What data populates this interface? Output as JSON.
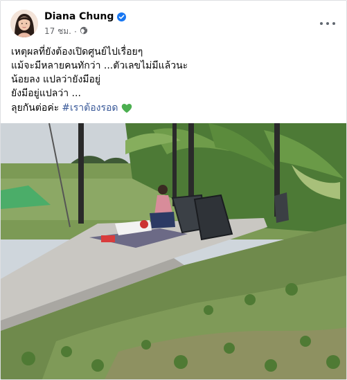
{
  "post": {
    "author_name": "Diana Chung",
    "timestamp": "17 ชม.",
    "separator": "·",
    "text_lines": [
      "เหตุผลที่ยังต้องเปิดศูนย์ไปเรื่อยๆ",
      "แม้จะมีหลายคนทักว่า ...ตัวเลขไม่มีแล้วนะ",
      "น้อยลง แปลว่ายังมีอยู่",
      "ยังมีอยู่แปลว่า ..."
    ],
    "closing_text": "ลุยกันต่อค่ะ",
    "hashtag": "#เราต้องรอด"
  },
  "icons": {
    "verified": "verified-badge-icon",
    "audience": "globe-icon",
    "more": "more-options-icon",
    "heart": "green-heart-emoji"
  },
  "colors": {
    "link": "#385898",
    "verified": "#1877f2",
    "meta": "#65676b",
    "heart": "#4caf50"
  }
}
